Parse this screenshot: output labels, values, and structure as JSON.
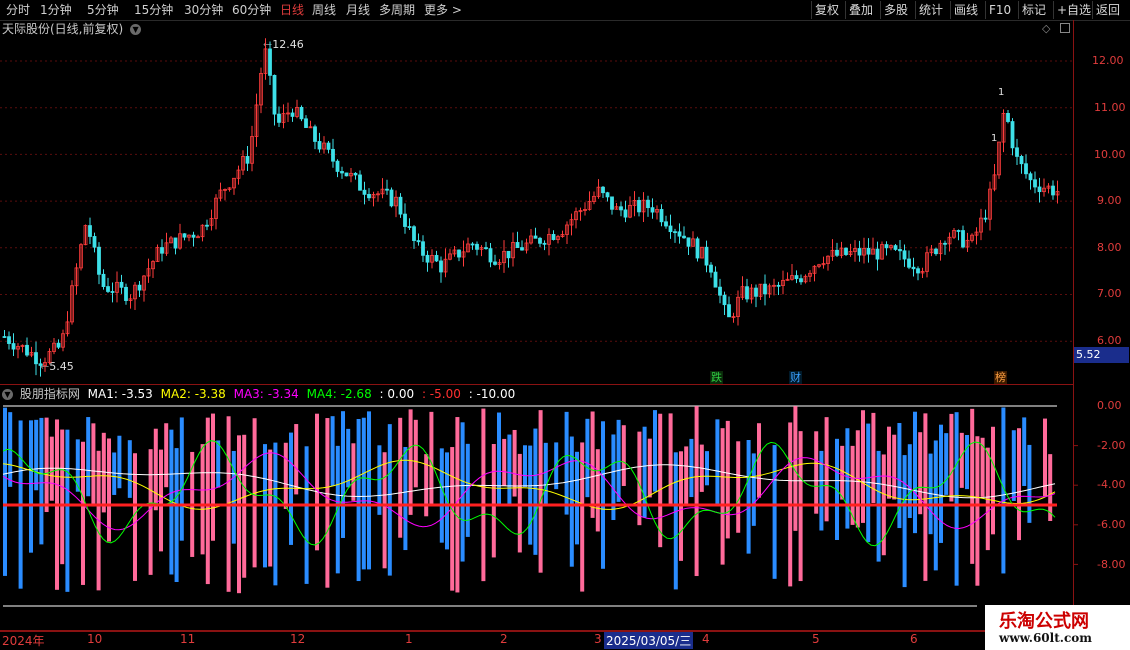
{
  "toolbar": {
    "timeframes": [
      "分时",
      "1分钟",
      "5分钟",
      "15分钟",
      "30分钟",
      "60分钟",
      "日线",
      "周线",
      "月线",
      "多周期",
      "更多 >"
    ],
    "active": "日线",
    "right_buttons": [
      "复权",
      "叠加",
      "多股",
      "统计",
      "画线",
      "F10",
      "标记",
      "+自选",
      "返回"
    ]
  },
  "main_chart": {
    "title": "天际股份(日线,前复权)",
    "price_axis": [
      "12.00",
      "11.00",
      "10.00",
      "9.00",
      "8.00",
      "7.00",
      "6.00"
    ],
    "high_label": "12.46",
    "low_label": "5.45",
    "current_price": "5.52",
    "markers": [
      {
        "text": "跌",
        "color": "#2ecc40",
        "bg": "#0a2a0a"
      },
      {
        "text": "财",
        "color": "#3aa0ff",
        "bg": "#001a2a"
      },
      {
        "text": "榜",
        "color": "#ffa040",
        "bg": "#3a1a00"
      }
    ],
    "peak_marks": [
      "1",
      "1"
    ]
  },
  "indicator": {
    "name": "股朋指标网",
    "ma1_label": "MA1:",
    "ma1": "-3.53",
    "ma2_label": "MA2:",
    "ma2": "-3.38",
    "ma3_label": "MA3:",
    "ma3": "-3.34",
    "ma4_label": "MA4:",
    "ma4": "-2.68",
    "v1": ": 0.00",
    "v2": ": -5.00",
    "v3": ": -10.00",
    "axis": [
      "0.00",
      "-2.00",
      "-4.00",
      "-6.00",
      "-8.00"
    ],
    "colors": {
      "ma1": "#ffffff",
      "ma2": "#ffff00",
      "ma3": "#ff00ff",
      "ma4": "#00ff00",
      "v1": "#ffffff",
      "v2": "#ff3030",
      "v3": "#ffffff"
    }
  },
  "date_axis": {
    "labels": [
      "2024年",
      "10",
      "11",
      "12",
      "1",
      "2",
      "3",
      "4",
      "5",
      "6"
    ],
    "selected": "2025/03/05/三"
  },
  "watermark": {
    "line1": "乐淘公式网",
    "line2": "www.60lt.com"
  }
}
